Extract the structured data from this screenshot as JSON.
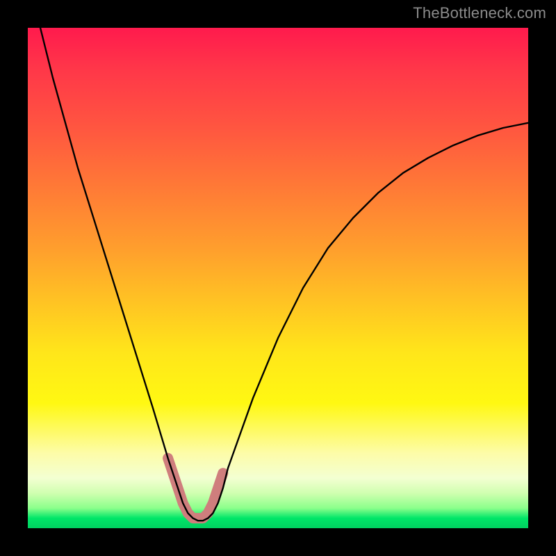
{
  "watermark": {
    "text": "TheBottleneck.com"
  },
  "chart_data": {
    "type": "line",
    "title": "",
    "xlabel": "",
    "ylabel": "",
    "xlim": [
      0,
      100
    ],
    "ylim": [
      0,
      100
    ],
    "grid": false,
    "series": [
      {
        "name": "bottleneck-curve",
        "x": [
          0,
          5,
          10,
          15,
          20,
          25,
          28,
          30,
          31,
          32,
          33,
          34,
          35,
          36,
          37,
          38,
          39,
          40,
          45,
          50,
          55,
          60,
          65,
          70,
          75,
          80,
          85,
          90,
          95,
          100
        ],
        "values": [
          110,
          90,
          72,
          56,
          40,
          24,
          14,
          8,
          5,
          3,
          2,
          1.5,
          1.5,
          2,
          3,
          5,
          8,
          12,
          26,
          38,
          48,
          56,
          62,
          67,
          71,
          74,
          76.5,
          78.5,
          80,
          81
        ]
      },
      {
        "name": "v-marker-band",
        "x": [
          28,
          29,
          30,
          31,
          32,
          33,
          34,
          35,
          36,
          37,
          38,
          39
        ],
        "values": [
          14,
          11,
          8,
          5,
          3,
          2,
          2,
          2,
          3,
          5,
          8,
          11
        ]
      }
    ],
    "marker_band": {
      "color": "#cf7e7d",
      "width": 15,
      "linecap": "round"
    },
    "curve_style": {
      "color": "#000000",
      "width": 2.4
    },
    "background": {
      "top_color": "#ff1a4d",
      "bottom_color": "#00d060",
      "note": "vertical red-to-green gradient through orange/yellow"
    }
  }
}
